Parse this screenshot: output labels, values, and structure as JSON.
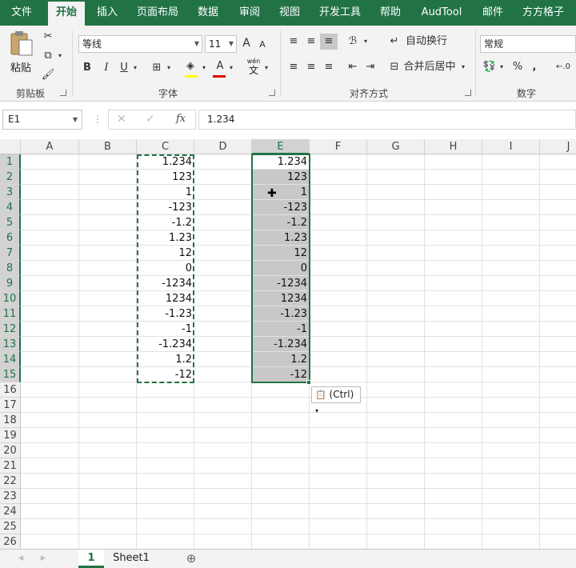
{
  "tabs": [
    "文件",
    "开始",
    "插入",
    "页面布局",
    "数据",
    "审阅",
    "视图",
    "开发工具",
    "帮助",
    "AudTool",
    "邮件",
    "方方格子"
  ],
  "active_tab": "开始",
  "clipboard": {
    "paste_label": "粘贴",
    "group_label": "剪贴板"
  },
  "font": {
    "family": "等线",
    "size": "11",
    "group_label": "字体",
    "bold": "B",
    "italic": "I",
    "underline": "U",
    "wen": "wén",
    "wen_char": "文",
    "grow": "A",
    "shrink": "A"
  },
  "alignment": {
    "wrap_label": "自动换行",
    "merge_label": "合并后居中",
    "group_label": "对齐方式"
  },
  "number": {
    "format": "常规",
    "group_label": "数字",
    "percent": "%",
    "comma": ","
  },
  "formula_bar": {
    "name_box": "E1",
    "fx": "fx",
    "formula": "1.234"
  },
  "columns": [
    "A",
    "B",
    "C",
    "D",
    "E",
    "F",
    "G",
    "H",
    "I",
    "J"
  ],
  "selected_column": "E",
  "rows": [
    "1",
    "2",
    "3",
    "4",
    "5",
    "6",
    "7",
    "8",
    "9",
    "10",
    "11",
    "12",
    "13",
    "14",
    "15",
    "16",
    "17",
    "18",
    "19",
    "20",
    "21",
    "22",
    "23",
    "24",
    "25",
    "26"
  ],
  "col_c_values": [
    "1.234",
    "123",
    "1",
    "-123",
    "-1.2",
    "1.23",
    "12",
    "0",
    "-1234",
    "1234",
    "-1.23",
    "-1",
    "-1.234",
    "1.2",
    "-12"
  ],
  "col_e_values": [
    "1.234",
    "123",
    "1",
    "-123",
    "-1.2",
    "1.23",
    "12",
    "0",
    "-1234",
    "1234",
    "-1.23",
    "-1",
    "-1.234",
    "1.2",
    "-12"
  ],
  "paste_options": "(Ctrl)",
  "sheets": [
    "1",
    "Sheet1"
  ],
  "active_sheet": "1",
  "colors": {
    "accent": "#217346",
    "selection_fill": "#c8c8c8"
  }
}
